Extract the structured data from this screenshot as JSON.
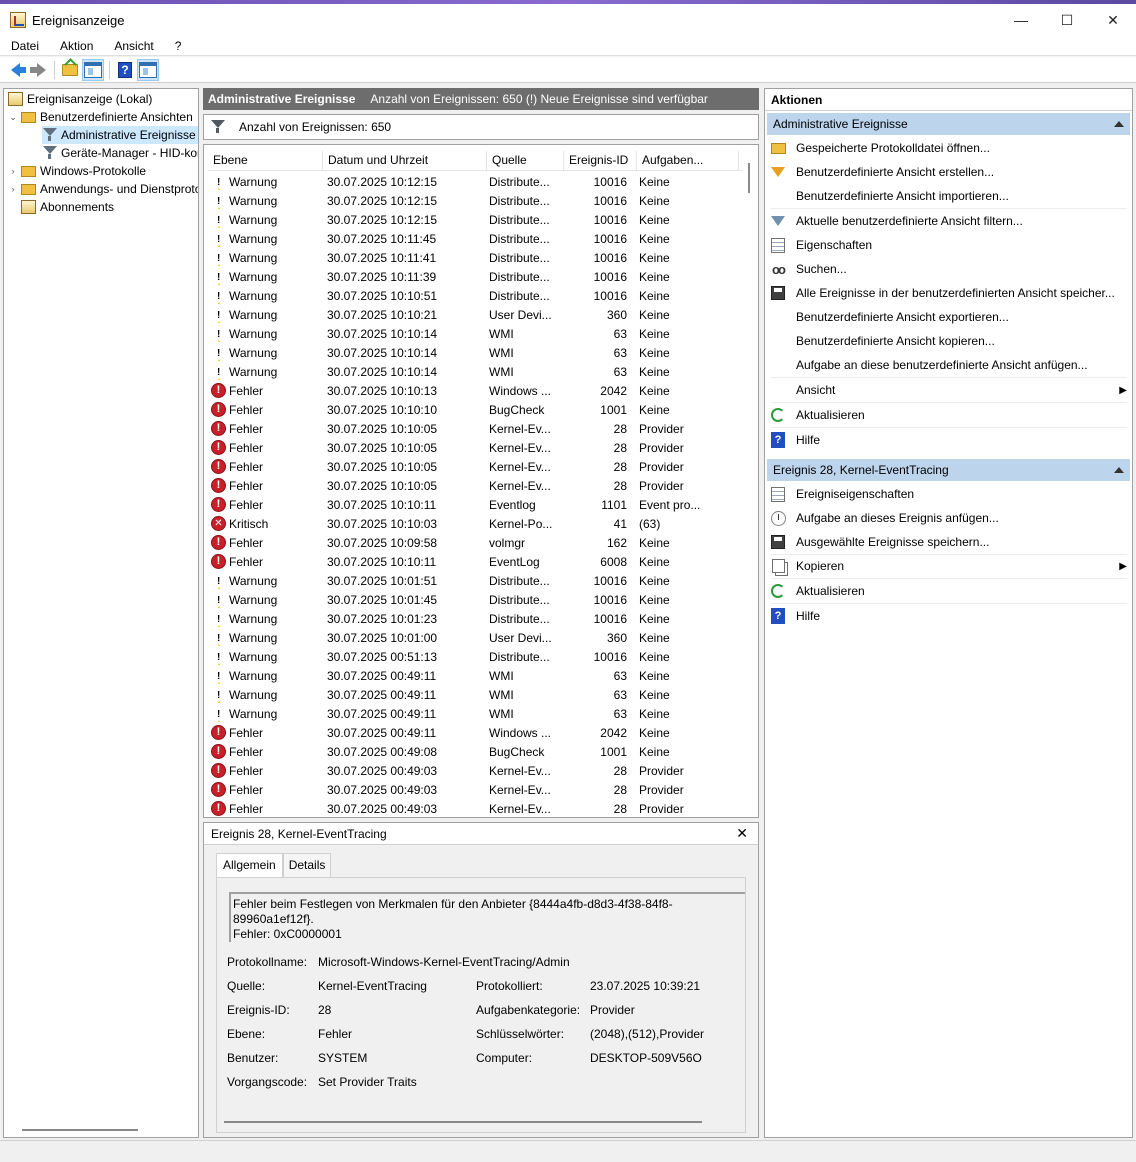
{
  "window": {
    "title": "Ereignisanzeige",
    "minimize": "—",
    "maximize": "☐",
    "close": "✕"
  },
  "menu": [
    "Datei",
    "Aktion",
    "Ansicht",
    "?"
  ],
  "tree": {
    "root": "Ereignisanzeige (Lokal)",
    "custom_views": "Benutzerdefinierte Ansichten",
    "admin_events": "Administrative Ereignisse",
    "device_manager": "Geräte-Manager - HID-kompatible Maus",
    "windows_logs": "Windows-Protokolle",
    "app_logs": "Anwendungs- und Dienstprotokolle",
    "subscriptions": "Abonnements"
  },
  "middle": {
    "header_title": "Administrative Ereignisse",
    "header_info": "Anzahl von Ereignissen: 650 (!) Neue Ereignisse sind verfügbar",
    "filter_text": "Anzahl von Ereignissen: 650",
    "columns": [
      "Ebene",
      "Datum und Uhrzeit",
      "Quelle",
      "Ereignis-ID",
      "Aufgaben..."
    ]
  },
  "events": [
    {
      "level": "warn",
      "label": "Warnung",
      "date": "30.07.2025 10:12:15",
      "source": "Distribute...",
      "id": "10016",
      "task": "Keine"
    },
    {
      "level": "warn",
      "label": "Warnung",
      "date": "30.07.2025 10:12:15",
      "source": "Distribute...",
      "id": "10016",
      "task": "Keine"
    },
    {
      "level": "warn",
      "label": "Warnung",
      "date": "30.07.2025 10:12:15",
      "source": "Distribute...",
      "id": "10016",
      "task": "Keine"
    },
    {
      "level": "warn",
      "label": "Warnung",
      "date": "30.07.2025 10:11:45",
      "source": "Distribute...",
      "id": "10016",
      "task": "Keine"
    },
    {
      "level": "warn",
      "label": "Warnung",
      "date": "30.07.2025 10:11:41",
      "source": "Distribute...",
      "id": "10016",
      "task": "Keine"
    },
    {
      "level": "warn",
      "label": "Warnung",
      "date": "30.07.2025 10:11:39",
      "source": "Distribute...",
      "id": "10016",
      "task": "Keine"
    },
    {
      "level": "warn",
      "label": "Warnung",
      "date": "30.07.2025 10:10:51",
      "source": "Distribute...",
      "id": "10016",
      "task": "Keine"
    },
    {
      "level": "warn",
      "label": "Warnung",
      "date": "30.07.2025 10:10:21",
      "source": "User Devi...",
      "id": "360",
      "task": "Keine"
    },
    {
      "level": "warn",
      "label": "Warnung",
      "date": "30.07.2025 10:10:14",
      "source": "WMI",
      "id": "63",
      "task": "Keine"
    },
    {
      "level": "warn",
      "label": "Warnung",
      "date": "30.07.2025 10:10:14",
      "source": "WMI",
      "id": "63",
      "task": "Keine"
    },
    {
      "level": "warn",
      "label": "Warnung",
      "date": "30.07.2025 10:10:14",
      "source": "WMI",
      "id": "63",
      "task": "Keine"
    },
    {
      "level": "err",
      "label": "Fehler",
      "date": "30.07.2025 10:10:13",
      "source": "Windows ...",
      "id": "2042",
      "task": "Keine"
    },
    {
      "level": "err",
      "label": "Fehler",
      "date": "30.07.2025 10:10:10",
      "source": "BugCheck",
      "id": "1001",
      "task": "Keine"
    },
    {
      "level": "err",
      "label": "Fehler",
      "date": "30.07.2025 10:10:05",
      "source": "Kernel-Ev...",
      "id": "28",
      "task": "Provider"
    },
    {
      "level": "err",
      "label": "Fehler",
      "date": "30.07.2025 10:10:05",
      "source": "Kernel-Ev...",
      "id": "28",
      "task": "Provider"
    },
    {
      "level": "err",
      "label": "Fehler",
      "date": "30.07.2025 10:10:05",
      "source": "Kernel-Ev...",
      "id": "28",
      "task": "Provider"
    },
    {
      "level": "err",
      "label": "Fehler",
      "date": "30.07.2025 10:10:05",
      "source": "Kernel-Ev...",
      "id": "28",
      "task": "Provider"
    },
    {
      "level": "err",
      "label": "Fehler",
      "date": "30.07.2025 10:10:11",
      "source": "Eventlog",
      "id": "1101",
      "task": "Event pro..."
    },
    {
      "level": "crit",
      "label": "Kritisch",
      "date": "30.07.2025 10:10:03",
      "source": "Kernel-Po...",
      "id": "41",
      "task": "(63)"
    },
    {
      "level": "err",
      "label": "Fehler",
      "date": "30.07.2025 10:09:58",
      "source": "volmgr",
      "id": "162",
      "task": "Keine"
    },
    {
      "level": "err",
      "label": "Fehler",
      "date": "30.07.2025 10:10:11",
      "source": "EventLog",
      "id": "6008",
      "task": "Keine"
    },
    {
      "level": "warn",
      "label": "Warnung",
      "date": "30.07.2025 10:01:51",
      "source": "Distribute...",
      "id": "10016",
      "task": "Keine"
    },
    {
      "level": "warn",
      "label": "Warnung",
      "date": "30.07.2025 10:01:45",
      "source": "Distribute...",
      "id": "10016",
      "task": "Keine"
    },
    {
      "level": "warn",
      "label": "Warnung",
      "date": "30.07.2025 10:01:23",
      "source": "Distribute...",
      "id": "10016",
      "task": "Keine"
    },
    {
      "level": "warn",
      "label": "Warnung",
      "date": "30.07.2025 10:01:00",
      "source": "User Devi...",
      "id": "360",
      "task": "Keine"
    },
    {
      "level": "warn",
      "label": "Warnung",
      "date": "30.07.2025 00:51:13",
      "source": "Distribute...",
      "id": "10016",
      "task": "Keine"
    },
    {
      "level": "warn",
      "label": "Warnung",
      "date": "30.07.2025 00:49:11",
      "source": "WMI",
      "id": "63",
      "task": "Keine"
    },
    {
      "level": "warn",
      "label": "Warnung",
      "date": "30.07.2025 00:49:11",
      "source": "WMI",
      "id": "63",
      "task": "Keine"
    },
    {
      "level": "warn",
      "label": "Warnung",
      "date": "30.07.2025 00:49:11",
      "source": "WMI",
      "id": "63",
      "task": "Keine"
    },
    {
      "level": "err",
      "label": "Fehler",
      "date": "30.07.2025 00:49:11",
      "source": "Windows ...",
      "id": "2042",
      "task": "Keine"
    },
    {
      "level": "err",
      "label": "Fehler",
      "date": "30.07.2025 00:49:08",
      "source": "BugCheck",
      "id": "1001",
      "task": "Keine"
    },
    {
      "level": "err",
      "label": "Fehler",
      "date": "30.07.2025 00:49:03",
      "source": "Kernel-Ev...",
      "id": "28",
      "task": "Provider"
    },
    {
      "level": "err",
      "label": "Fehler",
      "date": "30.07.2025 00:49:03",
      "source": "Kernel-Ev...",
      "id": "28",
      "task": "Provider"
    },
    {
      "level": "err",
      "label": "Fehler",
      "date": "30.07.2025 00:49:03",
      "source": "Kernel-Ev...",
      "id": "28",
      "task": "Provider"
    }
  ],
  "detail": {
    "title": "Ereignis 28, Kernel-EventTracing",
    "close": "✕",
    "tab_general": "Allgemein",
    "tab_details": "Details",
    "message_line1": "Fehler beim Festlegen von Merkmalen für den Anbieter {8444a4fb-d8d3-4f38-84f8-89960a1ef12f}.",
    "message_line2": "Fehler: 0xC0000001",
    "log_name_label": "Protokollname:",
    "log_name": "Microsoft-Windows-Kernel-EventTracing/Admin",
    "source_label": "Quelle:",
    "source": "Kernel-EventTracing",
    "logged_label": "Protokolliert:",
    "logged": "23.07.2025 10:39:21",
    "event_id_label": "Ereignis-ID:",
    "event_id": "28",
    "task_label": "Aufgabenkategorie:",
    "task": "Provider",
    "level_label": "Ebene:",
    "level": "Fehler",
    "keywords_label": "Schlüsselwörter:",
    "keywords": "(2048),(512),Provider",
    "user_label": "Benutzer:",
    "user": "SYSTEM",
    "computer_label": "Computer:",
    "computer": "DESKTOP-509V56O",
    "opcode_label": "Vorgangscode:",
    "opcode": "Set Provider Traits"
  },
  "actions": {
    "header": "Aktionen",
    "section1": "Administrative Ereignisse",
    "items1": [
      "Gespeicherte Protokolldatei öffnen...",
      "Benutzerdefinierte Ansicht erstellen...",
      "Benutzerdefinierte Ansicht importieren...",
      "Aktuelle benutzerdefinierte Ansicht filtern...",
      "Eigenschaften",
      "Suchen...",
      "Alle Ereignisse in der benutzerdefinierten Ansicht speicher...",
      "Benutzerdefinierte Ansicht exportieren...",
      "Benutzerdefinierte Ansicht kopieren...",
      "Aufgabe an diese benutzerdefinierte Ansicht anfügen...",
      "Ansicht",
      "Aktualisieren",
      "Hilfe"
    ],
    "section2": "Ereignis 28, Kernel-EventTracing",
    "items2": [
      "Ereigniseigenschaften",
      "Aufgabe an dieses Ereignis anfügen...",
      "Ausgewählte Ereignisse speichern...",
      "Kopieren",
      "Aktualisieren",
      "Hilfe"
    ],
    "submenu_arrow": "▶"
  }
}
